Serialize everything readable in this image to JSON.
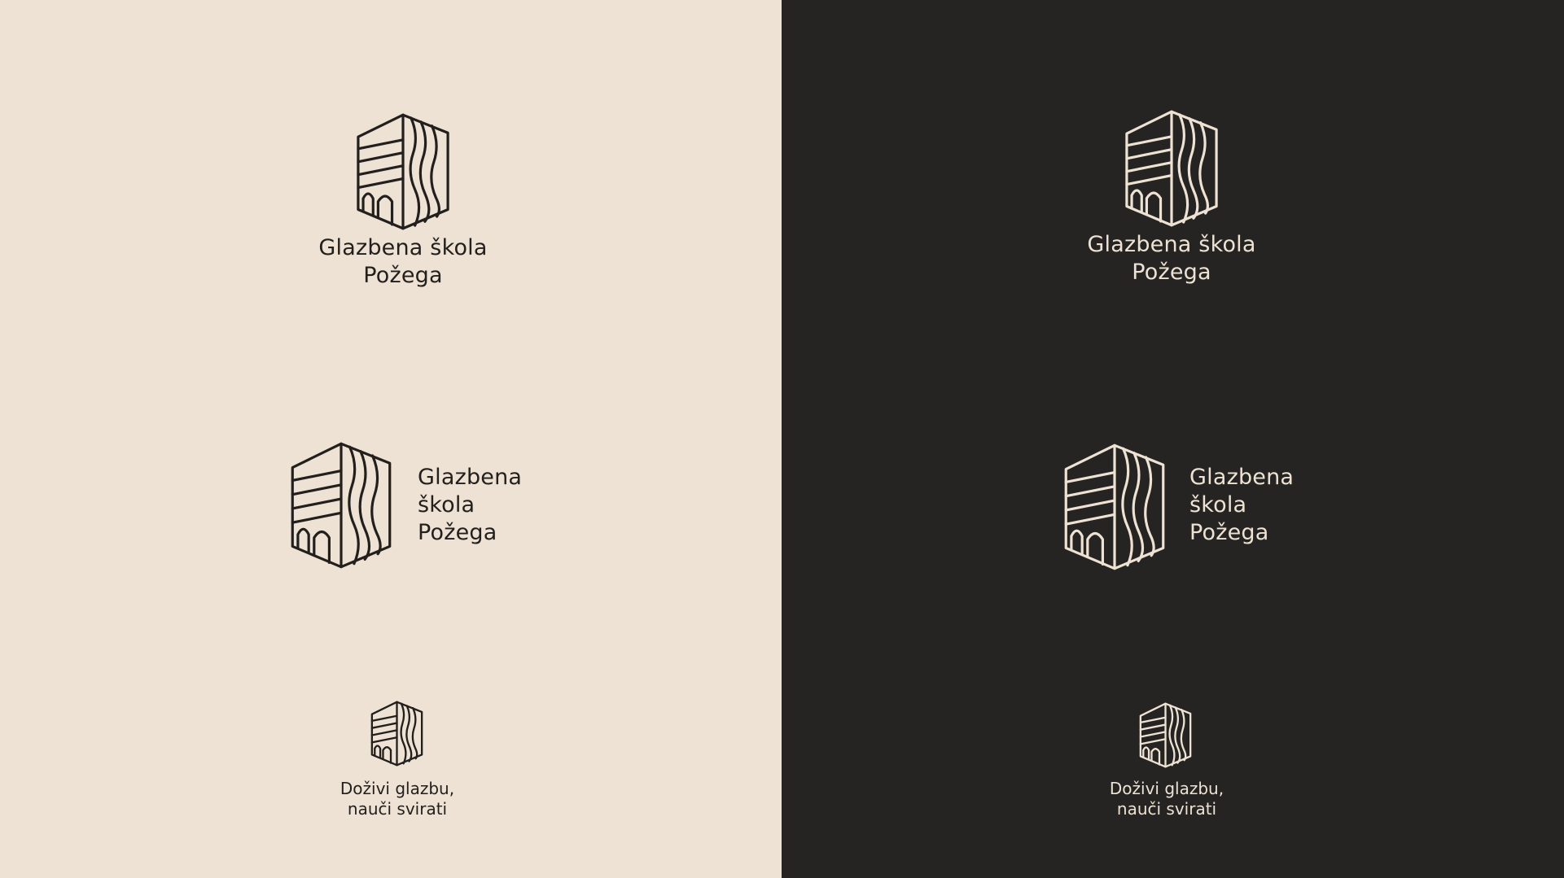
{
  "colors": {
    "light_background": "#ede2d3",
    "dark_background": "#252422",
    "ink_dark": "#231f1d",
    "ink_light": "#ede2d3"
  },
  "logo_icon": "hexagonal-building-with-arches-and-sound-waves-icon",
  "light_panel": {
    "stacked": {
      "name_line1": "Glazbena škola",
      "name_line2": "Požega"
    },
    "horizontal": {
      "name_line1": "Glazbena",
      "name_line2": "škola",
      "name_line3": "Požega"
    },
    "icon_with_tagline": {
      "tagline_line1": "Doživi glazbu,",
      "tagline_line2": "nauči svirati"
    }
  },
  "dark_panel": {
    "stacked": {
      "name_line1": "Glazbena škola",
      "name_line2": "Požega"
    },
    "horizontal": {
      "name_line1": "Glazbena",
      "name_line2": "škola",
      "name_line3": "Požega"
    },
    "icon_with_tagline": {
      "tagline_line1": "Doživi glazbu,",
      "tagline_line2": "nauči svirati"
    }
  }
}
